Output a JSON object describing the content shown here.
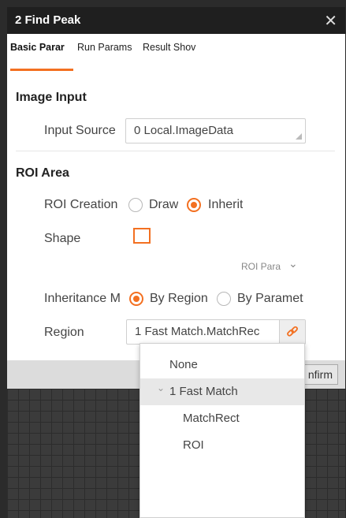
{
  "window": {
    "title": "2 Find Peak",
    "close": "✕"
  },
  "tabs": [
    "Basic Parar",
    "Run Params",
    "Result Shov"
  ],
  "image_input": {
    "heading": "Image Input",
    "input_source_label": "Input Source",
    "input_source_value": "0 Local.ImageData"
  },
  "roi": {
    "heading": "ROI Area",
    "creation_label": "ROI Creation",
    "draw_label": "Draw",
    "inherit_label": "Inherit",
    "shape_label": "Shape",
    "roi_param_link": "ROI Para",
    "roi_param_chevron": "⌄",
    "inheritance_label": "Inheritance M",
    "by_region_label": "By Region",
    "by_param_label": "By Paramet",
    "region_label": "Region",
    "region_value": "1 Fast Match.MatchRec"
  },
  "footer": {
    "confirm_label": "nfirm"
  },
  "dropdown": {
    "items": [
      {
        "label": "None"
      },
      {
        "label": "1 Fast Match",
        "expander": "⌄"
      },
      {
        "label": "MatchRect"
      },
      {
        "label": "ROI"
      }
    ]
  },
  "accent_color": "#f37021"
}
